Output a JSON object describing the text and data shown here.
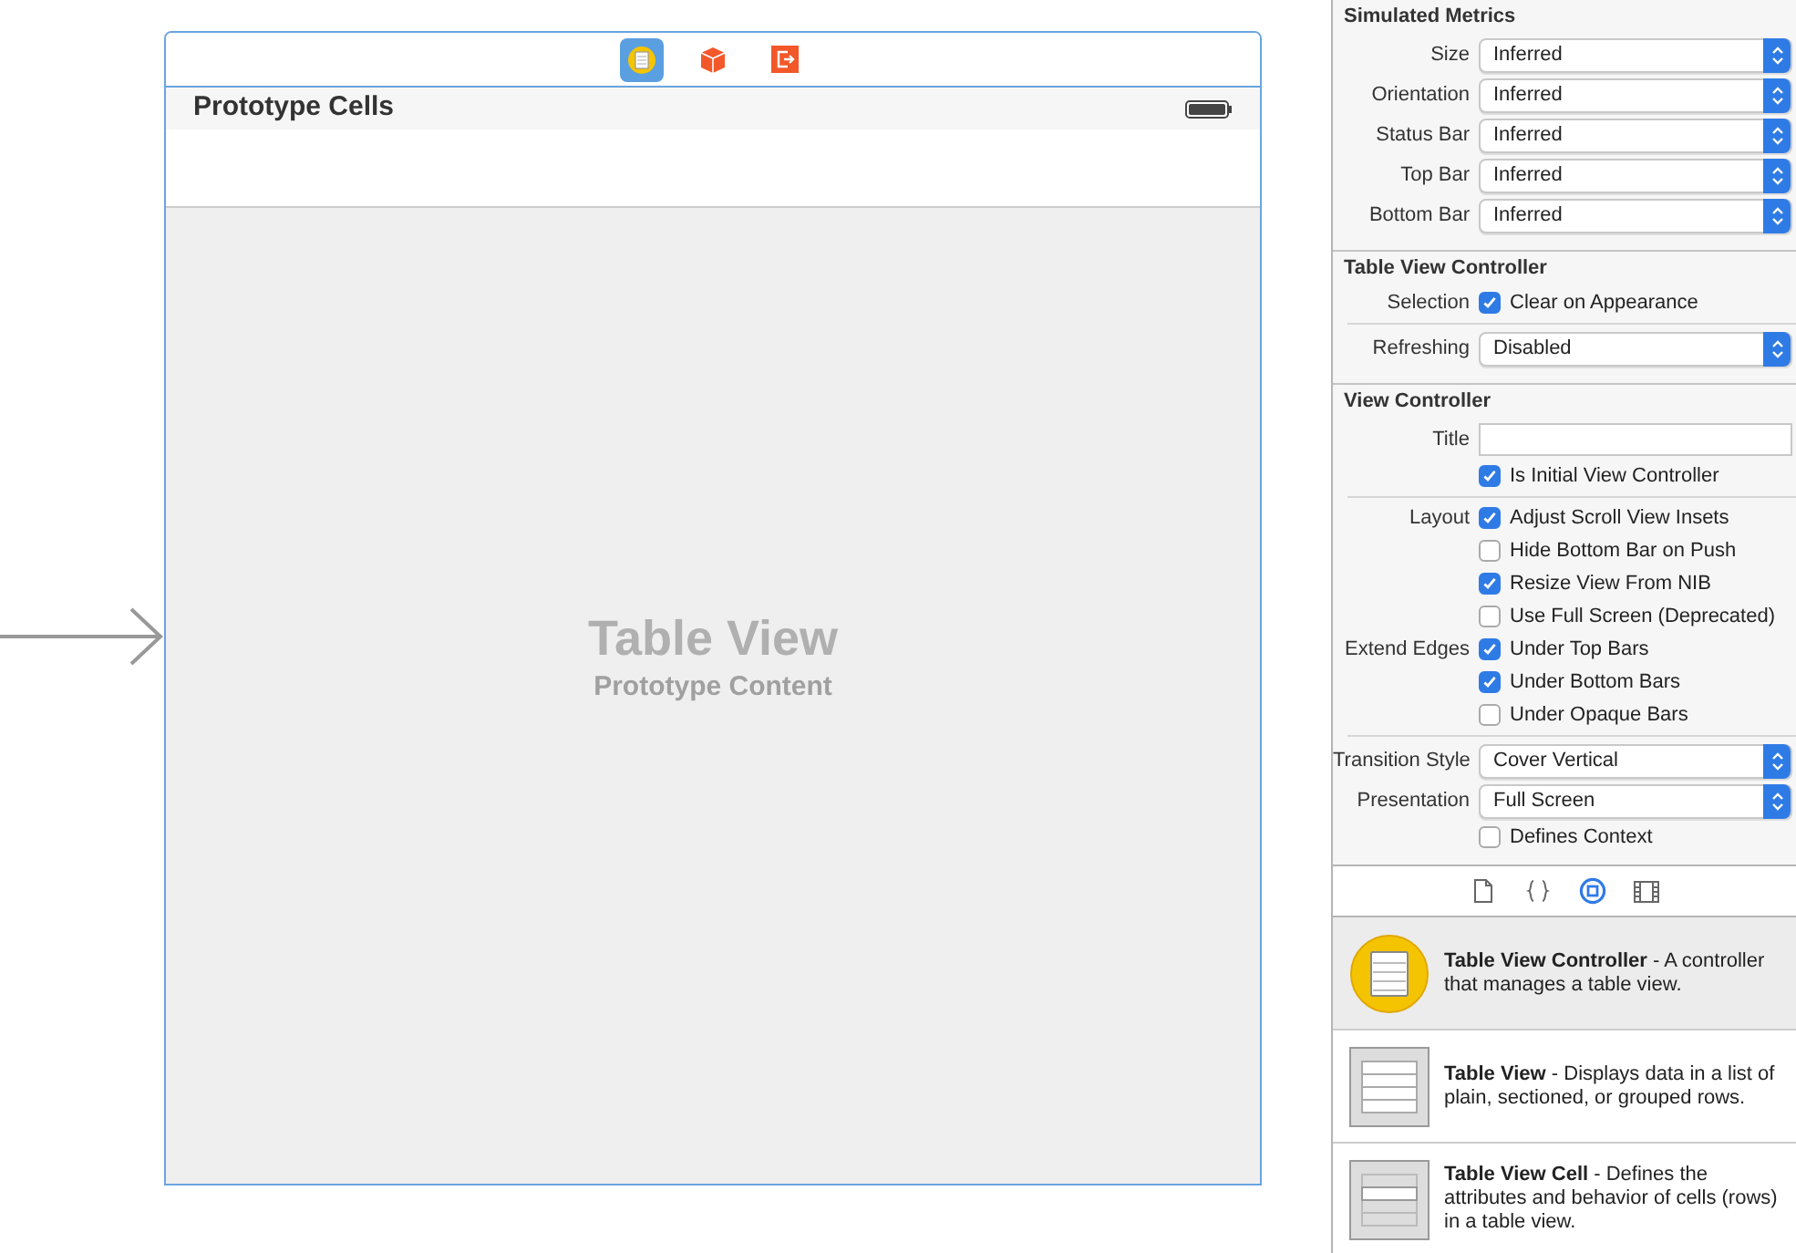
{
  "canvas": {
    "dock_icons": [
      {
        "kind": "controller",
        "selected": true
      },
      {
        "kind": "cube",
        "selected": false
      },
      {
        "kind": "exit",
        "selected": false
      }
    ],
    "nav_title": "Prototype Cells",
    "placeholder_title": "Table View",
    "placeholder_subtitle": "Prototype Content"
  },
  "inspector": {
    "sections": [
      {
        "title": "Simulated Metrics",
        "groups": [
          [
            {
              "kind": "popup",
              "label": "Size",
              "value": "Inferred"
            },
            {
              "kind": "popup",
              "label": "Orientation",
              "value": "Inferred"
            },
            {
              "kind": "popup",
              "label": "Status Bar",
              "value": "Inferred"
            },
            {
              "kind": "popup",
              "label": "Top Bar",
              "value": "Inferred"
            },
            {
              "kind": "popup",
              "label": "Bottom Bar",
              "value": "Inferred"
            }
          ]
        ]
      },
      {
        "title": "Table View Controller",
        "groups": [
          [
            {
              "kind": "checkbox",
              "label": "Selection",
              "text": "Clear on Appearance",
              "checked": true
            }
          ],
          [
            {
              "kind": "popup",
              "label": "Refreshing",
              "value": "Disabled"
            }
          ]
        ]
      },
      {
        "title": "View Controller",
        "groups": [
          [
            {
              "kind": "field",
              "label": "Title"
            },
            {
              "kind": "checkbox",
              "text": "Is Initial View Controller",
              "checked": true
            }
          ],
          [
            {
              "kind": "checkbox",
              "label": "Layout",
              "text": "Adjust Scroll View Insets",
              "checked": true
            },
            {
              "kind": "checkbox",
              "text": "Hide Bottom Bar on Push",
              "checked": false
            },
            {
              "kind": "checkbox",
              "text": "Resize View From NIB",
              "checked": true
            },
            {
              "kind": "checkbox",
              "text": "Use Full Screen (Deprecated)",
              "checked": false
            },
            {
              "kind": "checkbox",
              "label": "Extend Edges",
              "text": "Under Top Bars",
              "checked": true
            },
            {
              "kind": "checkbox",
              "text": "Under Bottom Bars",
              "checked": true
            },
            {
              "kind": "checkbox",
              "text": "Under Opaque Bars",
              "checked": false
            }
          ],
          [
            {
              "kind": "popup",
              "label": "Transition Style",
              "value": "Cover Vertical"
            },
            {
              "kind": "popup",
              "label": "Presentation",
              "value": "Full Screen"
            },
            {
              "kind": "checkbox",
              "text": "Defines Context",
              "checked": false
            }
          ]
        ]
      }
    ]
  },
  "library_tabs": [
    {
      "kind": "file",
      "selected": false
    },
    {
      "kind": "braces",
      "selected": false
    },
    {
      "kind": "object",
      "selected": true
    },
    {
      "kind": "media",
      "selected": false
    }
  ],
  "library": [
    {
      "kind": "controller",
      "name": "Table View Controller",
      "description": " - A controller that manages a table view.",
      "selected": true
    },
    {
      "kind": "table",
      "name": "Table View",
      "description": " - Displays data in a list of plain, sectioned, or grouped rows.",
      "selected": false
    },
    {
      "kind": "cell",
      "name": "Table View Cell",
      "description": " - Defines the attributes and behavior of cells (rows) in a table view.",
      "selected": false
    }
  ]
}
